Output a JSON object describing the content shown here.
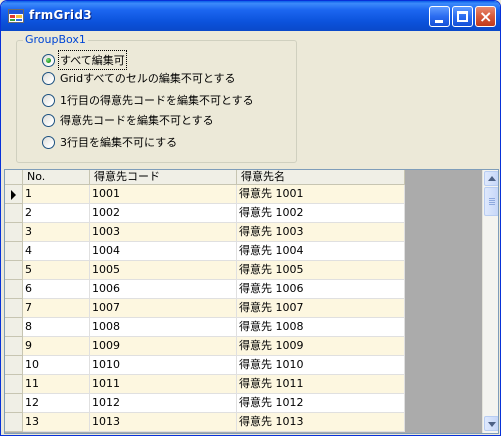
{
  "window": {
    "title": "frmGrid3"
  },
  "groupbox": {
    "title": "GroupBox1",
    "options": [
      {
        "label": "すべて編集可",
        "checked": true
      },
      {
        "label": "Gridすべてのセルの編集不可とする",
        "checked": false
      },
      {
        "label": "1行目の得意先コードを編集不可とする",
        "checked": false
      },
      {
        "label": "得意先コードを編集不可とする",
        "checked": false
      },
      {
        "label": "3行目を編集不可にする",
        "checked": false
      }
    ]
  },
  "grid": {
    "columns": [
      "No.",
      "得意先コード",
      "得意先名"
    ],
    "current_row": 1,
    "rows": [
      [
        "1",
        "1001",
        "得意先 1001"
      ],
      [
        "2",
        "1002",
        "得意先 1002"
      ],
      [
        "3",
        "1003",
        "得意先 1003"
      ],
      [
        "4",
        "1004",
        "得意先 1004"
      ],
      [
        "5",
        "1005",
        "得意先 1005"
      ],
      [
        "6",
        "1006",
        "得意先 1006"
      ],
      [
        "7",
        "1007",
        "得意先 1007"
      ],
      [
        "8",
        "1008",
        "得意先 1008"
      ],
      [
        "9",
        "1009",
        "得意先 1009"
      ],
      [
        "10",
        "1010",
        "得意先 1010"
      ],
      [
        "11",
        "1011",
        "得意先 1011"
      ],
      [
        "12",
        "1012",
        "得意先 1012"
      ],
      [
        "13",
        "1013",
        "得意先 1013"
      ]
    ]
  },
  "icons": {
    "app": "app-window-icon",
    "minimize": "minimize-icon",
    "maximize": "maximize-icon",
    "close": "close-icon",
    "current_row": "current-row-arrow-icon",
    "scroll_up": "scroll-up-arrow-icon",
    "scroll_down": "scroll-down-arrow-icon"
  },
  "colors": {
    "titlebar": "#0b52db",
    "groupbox_title": "#0046d5",
    "alt_row": "#fdf7e0",
    "radio_checked": "#21a121"
  }
}
